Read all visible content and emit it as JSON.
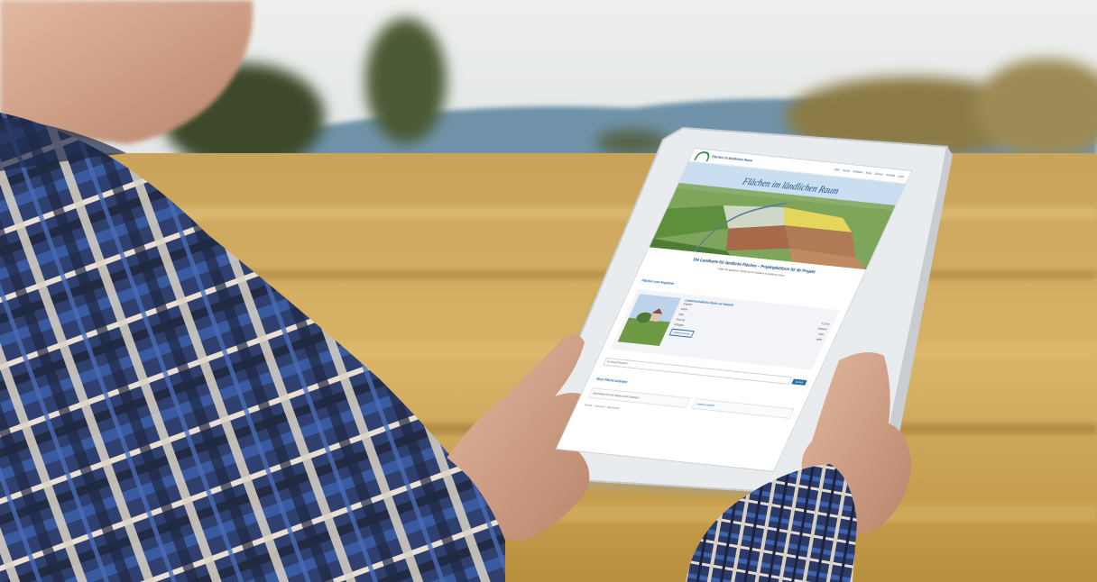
{
  "screen": {
    "logo_text": "Flächen im ländlichen Raum",
    "nav": [
      "Start",
      "Suche",
      "Anbieten",
      "Karte",
      "Service",
      "Kontakt",
      "Login"
    ],
    "hero_title": "Flächen im ländlichen Raum",
    "intro_title": "Die Landkarte für ländliche Flächen – Projektplattform für Ihr Projekt",
    "intro_text": "Finden Sie geeignete Flächen für Ihr Vorhaben im ländlichen Raum.",
    "section_link": "Flächen und Angebote",
    "card": {
      "title": "Landwirtschaftliche Fläche mit Hofstelle",
      "subtitle": "Angebot",
      "rows": [
        {
          "label": "Größe",
          "value": "12,5 ha"
        },
        {
          "label": "Lage",
          "value": "Ortsrand"
        },
        {
          "label": "Nutzung",
          "value": "Acker"
        },
        {
          "label": "Verfügbar",
          "value": "sofort"
        }
      ],
      "button": "Details ansehen"
    },
    "search_placeholder": "Suchbegriff eingeben",
    "search_button": "Suchen",
    "form_heading": "Neue Fläche anbieten",
    "form_text": "Beschreiben Sie Ihre Fläche und Ihr Vorhaben.",
    "form_link": "Angebot erstellen",
    "footer": "Kontakt · Impressum · Datenschutz"
  }
}
